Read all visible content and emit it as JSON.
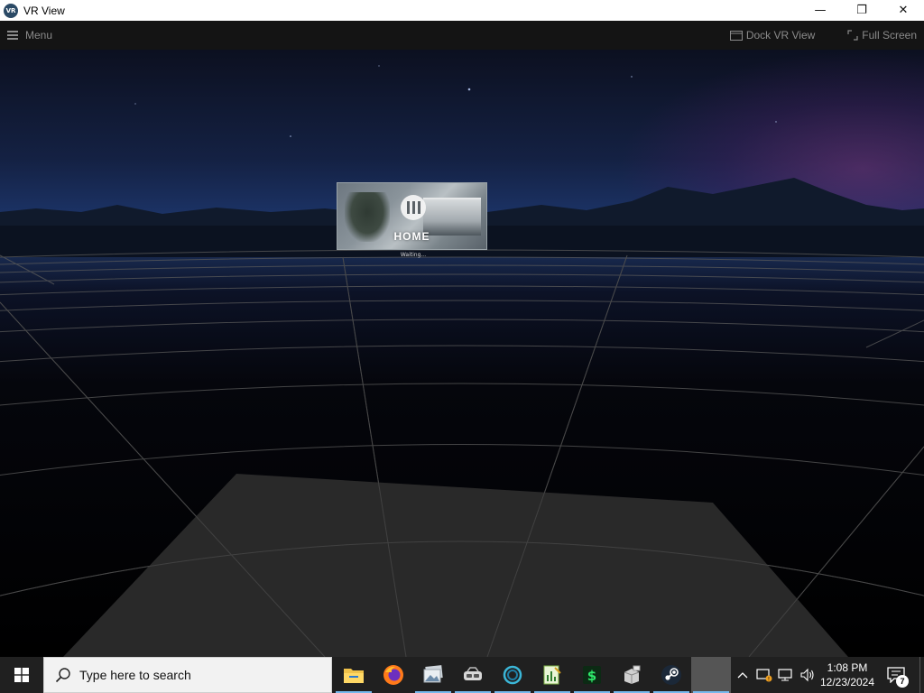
{
  "window": {
    "title": "VR View",
    "app_icon_text": "VR",
    "controls": {
      "minimize": "—",
      "restore": "❐",
      "close": "✕"
    }
  },
  "menubar": {
    "menu_label": "Menu",
    "dock_label": "Dock VR View",
    "fullscreen_label": "Full Screen"
  },
  "vr_view": {
    "home_card": {
      "label": "HOME",
      "status": "Waiting..."
    }
  },
  "taskbar": {
    "search_placeholder": "Type here to search",
    "apps": [
      {
        "name": "file-explorer",
        "running": true
      },
      {
        "name": "firefox",
        "running": false
      },
      {
        "name": "photos",
        "running": true
      },
      {
        "name": "vr-headset-app",
        "running": true
      },
      {
        "name": "circle-app",
        "running": true
      },
      {
        "name": "notepad-chart-app",
        "running": true
      },
      {
        "name": "dollar-app",
        "running": true
      },
      {
        "name": "vr-box-app",
        "running": true
      },
      {
        "name": "steam",
        "running": true
      },
      {
        "name": "blank-app",
        "running": true
      }
    ],
    "clock": {
      "time": "1:08 PM",
      "date": "12/23/2024"
    },
    "notification_count": "7"
  },
  "colors": {
    "taskbar_bg": "#202020",
    "menubar_bg": "#141414",
    "accent_running": "#76b9ed",
    "steam_blue": "#1b2838"
  }
}
